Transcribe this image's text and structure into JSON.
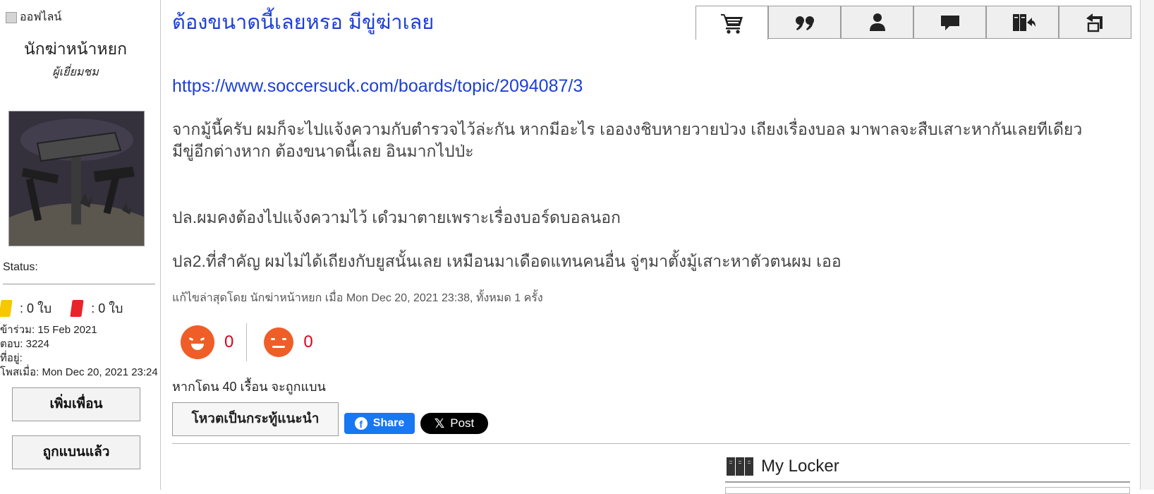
{
  "user": {
    "online_status": "ออฟไลน์",
    "username": "นักฆ่าหน้าหยก",
    "role": "ผู้เยี่ยมชม",
    "status_label": "Status:",
    "yellow_cards": ": 0 ใบ",
    "red_cards": ": 0 ใบ",
    "joined": "ข้าร่วม: 15 Feb 2021",
    "replies": "ตอบ: 3224",
    "address": "ที่อยู่:",
    "last_post": "โพสเมื่อ: Mon Dec 20, 2021 23:24",
    "add_friend_label": "เพิ่มเพื่อน",
    "banned_label": "ถูกแบนแล้ว"
  },
  "post": {
    "title": "ต้องขนาดนี้เลยหรอ มีขู่ฆ่าเลย",
    "link": "https://www.soccersuck.com/boards/topic/2094087/3",
    "body_line1": "จากมู้นี้ครับ ผมก็จะไปแจ้งความกับตำรวจไว้ล่ะกัน หากมีอะไร เอองงชิบหายวายป่วง เถียงเรื่องบอล มาพาลจะสืบเสาะหากันเลยทีเดียว",
    "body_line2": "มีขู่อีกต่างหาก ต้องขนาดนี้เลย อินมากไปป่ะ",
    "body_ps1": "ปล.ผมคงต้องไปแจ้งความไว้ เดํวมาตายเพราะเรื่องบอร์ดบอลนอก",
    "body_ps2": "ปล2.ที่สำคัญ ผมไม่ได้เถียงกับยูสนั้นเลย เหมือนมาเดือดแทนคนอื่น จู่ๆมาตั้งมู้เสาะหาตัวตนผม เออ",
    "edit_note": "แก้ไขล่าสุดโดย นักฆ่าหน้าหยก เมื่อ Mon Dec 20, 2021 23:38, ทั้งหมด 1 ครั้ง",
    "laugh_count": "0",
    "sad_count": "0",
    "ban_note": "หากโดน 40 เรื้อน จะถูกแบน",
    "vote_label": "โหวตเป็นกระทู้แนะนำ",
    "fb_share_label": "Share",
    "x_post_label": "Post"
  },
  "toolbar": {
    "icons": [
      "cart-icon",
      "quote-icon",
      "user-icon",
      "message-icon",
      "locker-icon",
      "reply-icon"
    ]
  },
  "locker": {
    "title": "My Locker"
  },
  "colors": {
    "title_blue": "#1c3fd6",
    "reaction_red": "#e0001b",
    "reaction_orange": "#ef5e26",
    "facebook_blue": "#1877f2"
  }
}
